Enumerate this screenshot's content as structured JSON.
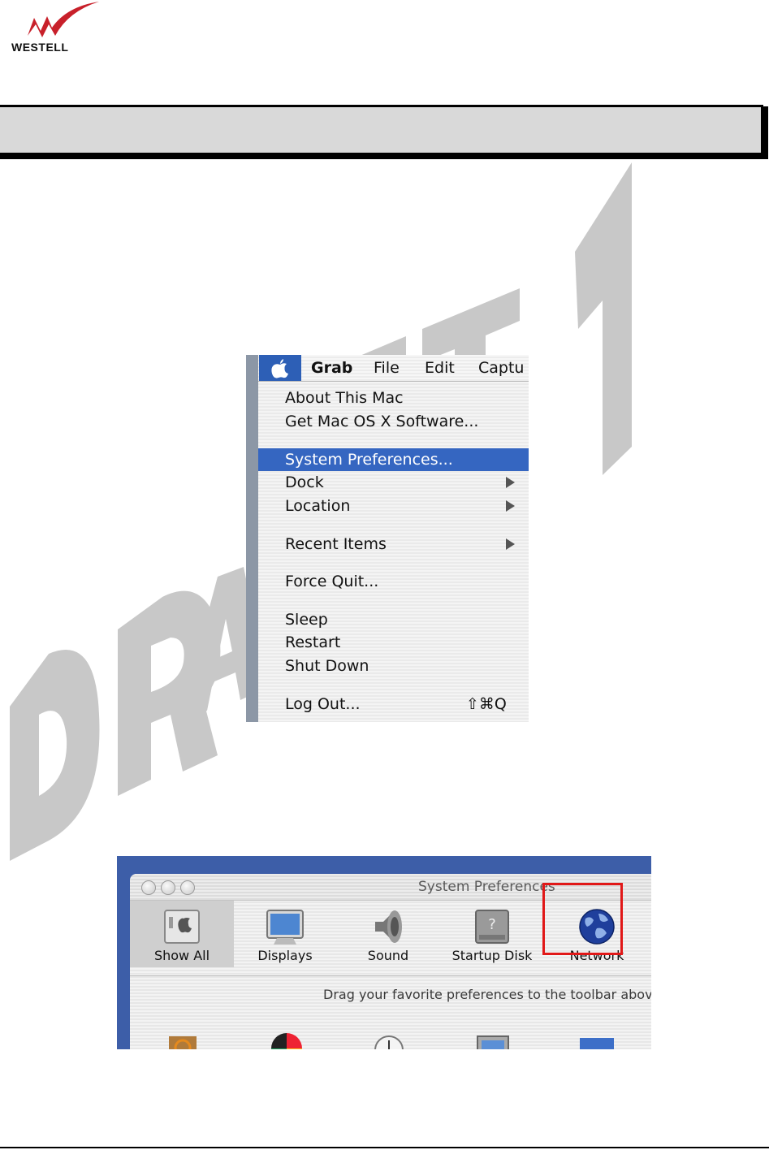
{
  "logo": {
    "brand": "WESTELL"
  },
  "watermark": {
    "text": "DRAFT 1"
  },
  "apple_menu": {
    "menubar": {
      "apple_icon": "apple-icon",
      "items": [
        "Grab",
        "File",
        "Edit",
        "Captu"
      ]
    },
    "items": [
      {
        "label": "About This Mac"
      },
      {
        "label": "Get Mac OS X Software..."
      },
      {
        "label": "System Preferences...",
        "selected": true
      },
      {
        "label": "Dock",
        "submenu": true
      },
      {
        "label": "Location",
        "submenu": true
      },
      {
        "label": "Recent Items",
        "submenu": true
      },
      {
        "label": "Force Quit..."
      },
      {
        "label": "Sleep"
      },
      {
        "label": "Restart"
      },
      {
        "label": "Shut Down"
      },
      {
        "label": "Log Out...",
        "shortcut": "⇧⌘Q"
      }
    ],
    "selection_color": "#3566c1"
  },
  "system_preferences": {
    "title": "System Preferences",
    "toolbar": [
      {
        "label": "Show All",
        "icon": "show-all-icon"
      },
      {
        "label": "Displays",
        "icon": "displays-icon"
      },
      {
        "label": "Sound",
        "icon": "sound-icon"
      },
      {
        "label": "Startup Disk",
        "icon": "startup-disk-icon"
      },
      {
        "label": "Network",
        "icon": "network-globe-icon",
        "highlighted": true
      }
    ],
    "hint": "Drag your favorite preferences to the toolbar abov",
    "highlight_color": "#e11818"
  }
}
